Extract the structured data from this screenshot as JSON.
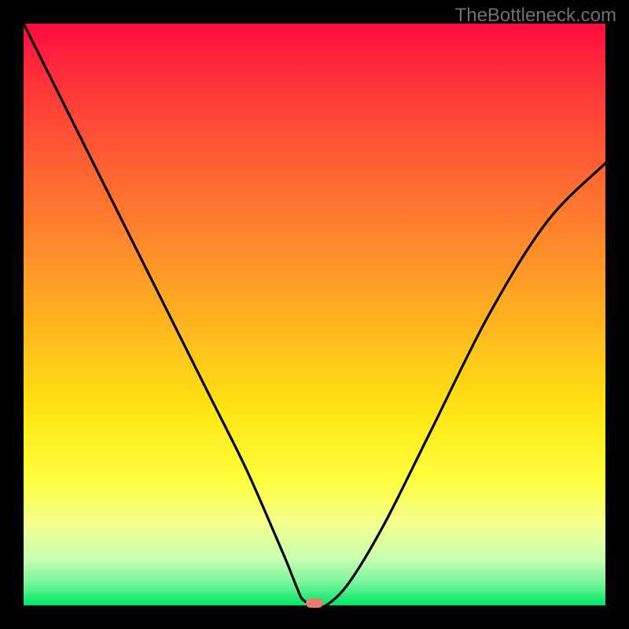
{
  "attribution": "TheBottleneck.com",
  "colors": {
    "frame": "#000000",
    "gradient_top": "#ff0c3e",
    "gradient_mid_orange": "#ff8a2b",
    "gradient_mid_yellow": "#ffe313",
    "gradient_bottom": "#00e765",
    "curve": "#000000",
    "marker": "#e77a73"
  },
  "chart_data": {
    "type": "line",
    "title": "",
    "xlabel": "",
    "ylabel": "",
    "xlim": [
      0,
      100
    ],
    "ylim": [
      0,
      100
    ],
    "grid": false,
    "legend": false,
    "series": [
      {
        "name": "bottleneck-curve",
        "x": [
          0,
          8,
          16,
          24,
          32,
          38,
          42,
          45,
          47,
          48,
          50,
          52,
          56,
          62,
          70,
          80,
          90,
          100
        ],
        "values": [
          100,
          84,
          68,
          52,
          36,
          24,
          15,
          8,
          3,
          1,
          0,
          0,
          4,
          14,
          30,
          50,
          66,
          76
        ]
      }
    ],
    "marker": {
      "x_pct": 50,
      "y_pct": 0
    },
    "note": "Axis-less bottleneck V-curve. x is an unlabeled horizontal percentage (0-100 left→right); values are vertical deviation percentage where 0 is bottom (green / no bottleneck) and 100 is top (red / severe bottleneck). Values estimated from curve shape; no numeric labels present in source image."
  }
}
